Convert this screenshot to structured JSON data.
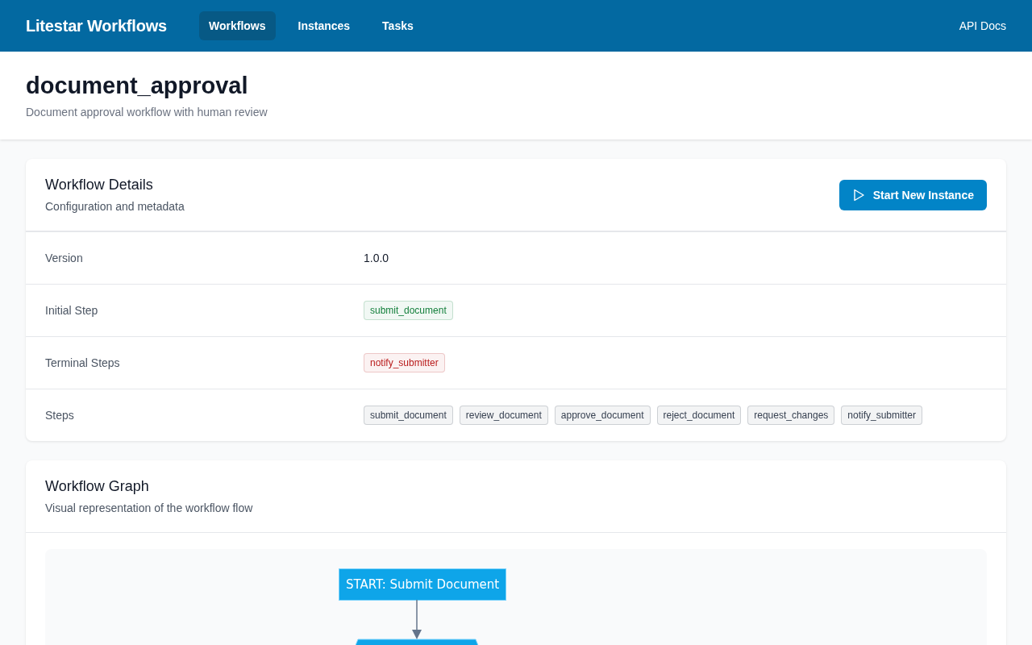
{
  "header": {
    "brand": "Litestar Workflows",
    "nav": [
      {
        "label": "Workflows",
        "selected": true
      },
      {
        "label": "Instances",
        "selected": false
      },
      {
        "label": "Tasks",
        "selected": false
      }
    ],
    "api_link": "API Docs"
  },
  "page": {
    "title": "document_approval",
    "subtitle": "Document approval workflow with human review"
  },
  "details": {
    "title": "Workflow Details",
    "subtitle": "Configuration and metadata",
    "action": "Start New Instance",
    "rows": [
      {
        "label": "Version",
        "kind": "text",
        "value": "1.0.0"
      },
      {
        "label": "Initial Step",
        "kind": "tags",
        "tags": [
          {
            "text": "submit_document",
            "color": "#15803d"
          }
        ]
      },
      {
        "label": "Terminal Steps",
        "kind": "tags",
        "tags": [
          {
            "text": "notify_submitter",
            "color": "#b91c1c"
          }
        ]
      },
      {
        "label": "Steps",
        "kind": "tags",
        "tags": [
          {
            "text": "submit_document",
            "color": "#374151"
          },
          {
            "text": "review_document",
            "color": "#374151"
          },
          {
            "text": "approve_document",
            "color": "#374151"
          },
          {
            "text": "reject_document",
            "color": "#374151"
          },
          {
            "text": "request_changes",
            "color": "#374151"
          },
          {
            "text": "notify_submitter",
            "color": "#374151"
          }
        ]
      }
    ]
  },
  "graph": {
    "title": "Workflow Graph",
    "subtitle": "Visual representation of the workflow flow",
    "nodes": [
      {
        "kind": "rect",
        "label": "START: Submit Document"
      },
      {
        "kind": "hexagon"
      }
    ]
  }
}
